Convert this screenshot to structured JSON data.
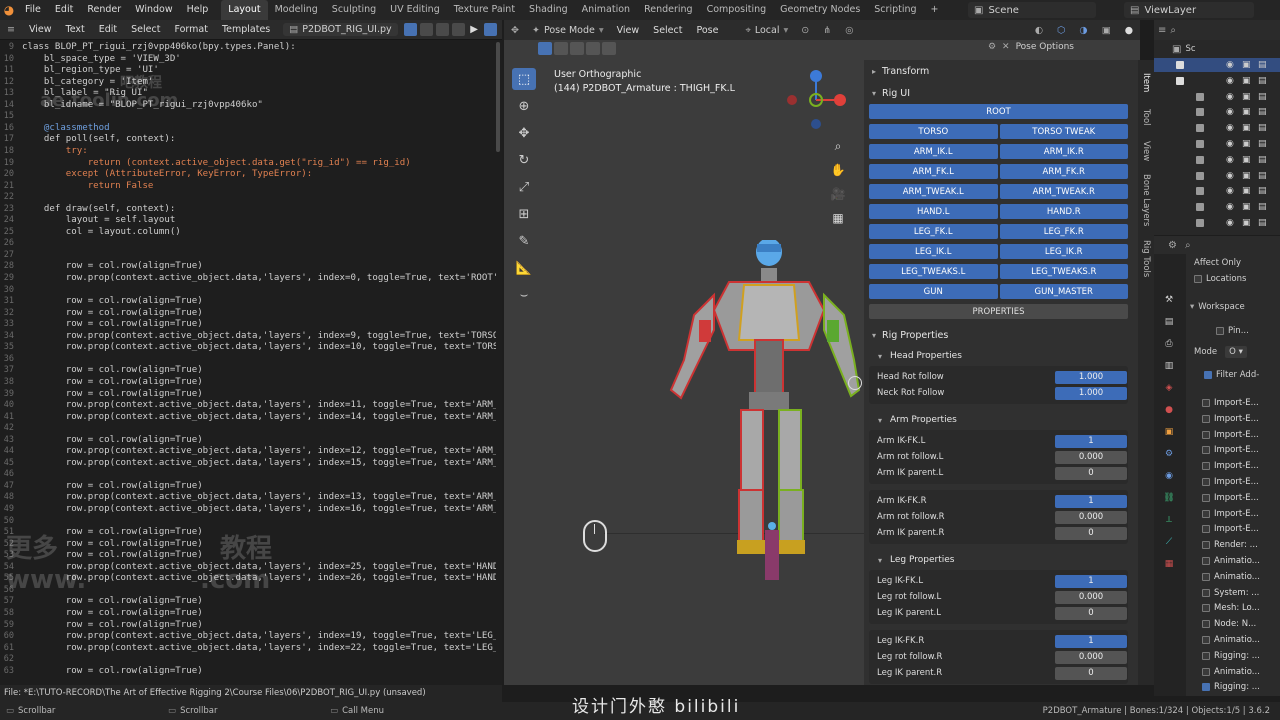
{
  "topbar": {
    "menus": [
      "File",
      "Edit",
      "Render",
      "Window",
      "Help"
    ],
    "workspaces": [
      "Layout",
      "Modeling",
      "Sculpting",
      "UV Editing",
      "Texture Paint",
      "Shading",
      "Animation",
      "Rendering",
      "Compositing",
      "Geometry Nodes",
      "Scripting"
    ],
    "active_workspace": "Layout",
    "add_tab": "+",
    "scene": "Scene",
    "view_layer": "ViewLayer"
  },
  "editor": {
    "menus": [
      "View",
      "Text",
      "Edit",
      "Select",
      "Format",
      "Templates"
    ],
    "filename": "P2DBOT_RIG_UI.py",
    "filepath": "File: *E:\\TUTO-RECORD\\The Art of Effective Rigging 2\\Course Files\\06\\P2DBOT_RIG_UI.py (unsaved)",
    "lines": [
      {
        "n": "9",
        "t": "class BLOP_PT_rigui_rzj0vpp406ko(bpy.types.Panel):"
      },
      {
        "n": "10",
        "t": "    bl_space_type = 'VIEW_3D'"
      },
      {
        "n": "11",
        "t": "    bl_region_type = 'UI'"
      },
      {
        "n": "12",
        "t": "    bl_category = 'Item'"
      },
      {
        "n": "13",
        "t": "    bl_label = \"Rig UI\""
      },
      {
        "n": "14",
        "t": "    bl_idname = \"BLOP_PT_rigui_rzj0vpp406ko\""
      },
      {
        "n": "15",
        "t": ""
      },
      {
        "n": "16",
        "t": "    @classmethod"
      },
      {
        "n": "17",
        "t": "    def poll(self, context):"
      },
      {
        "n": "18",
        "t": "        try:"
      },
      {
        "n": "19",
        "t": "            return (context.active_object.data.get(\"rig_id\") == rig_id)"
      },
      {
        "n": "20",
        "t": "        except (AttributeError, KeyError, TypeError):"
      },
      {
        "n": "21",
        "t": "            return False"
      },
      {
        "n": "22",
        "t": ""
      },
      {
        "n": "23",
        "t": "    def draw(self, context):"
      },
      {
        "n": "24",
        "t": "        layout = self.layout"
      },
      {
        "n": "25",
        "t": "        col = layout.column()"
      },
      {
        "n": "26",
        "t": ""
      },
      {
        "n": "27",
        "t": ""
      },
      {
        "n": "28",
        "t": "        row = col.row(align=True)"
      },
      {
        "n": "29",
        "t": "        row.prop(context.active_object.data,'layers', index=0, toggle=True, text='ROOT')"
      },
      {
        "n": "30",
        "t": ""
      },
      {
        "n": "31",
        "t": "        row = col.row(align=True)"
      },
      {
        "n": "32",
        "t": "        row = col.row(align=True)"
      },
      {
        "n": "33",
        "t": "        row = col.row(align=True)"
      },
      {
        "n": "34",
        "t": "        row.prop(context.active_object.data,'layers', index=9, toggle=True, text='TORSO')"
      },
      {
        "n": "35",
        "t": "        row.prop(context.active_object.data,'layers', index=10, toggle=True, text='TORSO"
      },
      {
        "n": "36",
        "t": ""
      },
      {
        "n": "37",
        "t": "        row = col.row(align=True)"
      },
      {
        "n": "38",
        "t": "        row = col.row(align=True)"
      },
      {
        "n": "39",
        "t": "        row = col.row(align=True)"
      },
      {
        "n": "40",
        "t": "        row.prop(context.active_object.data,'layers', index=11, toggle=True, text='ARM_IK"
      },
      {
        "n": "41",
        "t": "        row.prop(context.active_object.data,'layers', index=14, toggle=True, text='ARM_IK"
      },
      {
        "n": "42",
        "t": ""
      },
      {
        "n": "43",
        "t": "        row = col.row(align=True)"
      },
      {
        "n": "44",
        "t": "        row.prop(context.active_object.data,'layers', index=12, toggle=True, text='ARM_FK"
      },
      {
        "n": "45",
        "t": "        row.prop(context.active_object.data,'layers', index=15, toggle=True, text='ARM_FK"
      },
      {
        "n": "46",
        "t": ""
      },
      {
        "n": "47",
        "t": "        row = col.row(align=True)"
      },
      {
        "n": "48",
        "t": "        row.prop(context.active_object.data,'layers', index=13, toggle=True, text='ARM_TW"
      },
      {
        "n": "49",
        "t": "        row.prop(context.active_object.data,'layers', index=16, toggle=True, text='ARM_TW"
      },
      {
        "n": "50",
        "t": ""
      },
      {
        "n": "51",
        "t": "        row = col.row(align=True)"
      },
      {
        "n": "52",
        "t": "        row = col.row(align=True)"
      },
      {
        "n": "53",
        "t": "        row = col.row(align=True)"
      },
      {
        "n": "54",
        "t": "        row.prop(context.active_object.data,'layers', index=25, toggle=True, text='HAND.L"
      },
      {
        "n": "55",
        "t": "        row.prop(context.active_object.data,'layers', index=26, toggle=True, text='HAND.R"
      },
      {
        "n": "56",
        "t": ""
      },
      {
        "n": "57",
        "t": "        row = col.row(align=True)"
      },
      {
        "n": "58",
        "t": "        row = col.row(align=True)"
      },
      {
        "n": "59",
        "t": "        row = col.row(align=True)"
      },
      {
        "n": "60",
        "t": "        row.prop(context.active_object.data,'layers', index=19, toggle=True, text='LEG_FK"
      },
      {
        "n": "61",
        "t": "        row.prop(context.active_object.data,'layers', index=22, toggle=True, text='LEG_FK"
      },
      {
        "n": "62",
        "t": ""
      },
      {
        "n": "63",
        "t": "        row = col.row(align=True)"
      }
    ],
    "watermark_lines": [
      "更多",
      "教程",
      "www.",
      ".com",
      "ae.toolin.com",
      "吧教程"
    ]
  },
  "viewport": {
    "mode": "Pose Mode",
    "menus": [
      "View",
      "Select",
      "Pose"
    ],
    "orientation": "Local",
    "pose_options": "Pose Options",
    "view_name": "User Orthographic",
    "active_info": "(144) P2DBOT_Armature : THIGH_FK.L"
  },
  "npanel": {
    "transform_label": "Transform",
    "rigui_label": "Rig UI",
    "root_button": "ROOT",
    "button_rows": [
      [
        "TORSO",
        "TORSO TWEAK"
      ],
      [
        "ARM_IK.L",
        "ARM_IK.R"
      ],
      [
        "ARM_FK.L",
        "ARM_FK.R"
      ],
      [
        "ARM_TWEAK.L",
        "ARM_TWEAK.R"
      ],
      [
        "HAND.L",
        "HAND.R"
      ],
      [
        "LEG_FK.L",
        "LEG_FK.R"
      ],
      [
        "LEG_IK.L",
        "LEG_IK.R"
      ],
      [
        "LEG_TWEAKS.L",
        "LEG_TWEAKS.R"
      ],
      [
        "GUN",
        "GUN_MASTER"
      ]
    ],
    "properties_button": "PROPERTIES",
    "rig_properties_label": "Rig Properties",
    "head_properties_label": "Head Properties",
    "head_props": [
      {
        "label": "Head Rot follow",
        "value": "1.000"
      },
      {
        "label": "Neck Rot Follow",
        "value": "1.000"
      }
    ],
    "arm_properties_label": "Arm Properties",
    "arm_props_l": [
      {
        "label": "Arm IK-FK.L",
        "value": "1"
      },
      {
        "label": "Arm rot follow.L",
        "value": "0.000"
      },
      {
        "label": "Arm IK parent.L",
        "value": "0"
      }
    ],
    "arm_props_r": [
      {
        "label": "Arm IK-FK.R",
        "value": "1"
      },
      {
        "label": "Arm rot follow.R",
        "value": "0.000"
      },
      {
        "label": "Arm IK parent.R",
        "value": "0"
      }
    ],
    "leg_properties_label": "Leg Properties",
    "leg_props_l": [
      {
        "label": "Leg IK-FK.L",
        "value": "1"
      },
      {
        "label": "Leg rot follow.L",
        "value": "0.000"
      },
      {
        "label": "Leg IK parent.L",
        "value": "0"
      }
    ],
    "leg_props_r": [
      {
        "label": "Leg IK-FK.R",
        "value": "1"
      },
      {
        "label": "Leg rot follow.R",
        "value": "0.000"
      },
      {
        "label": "Leg IK parent.R",
        "value": "0"
      }
    ],
    "vertical_tabs": [
      "Item",
      "Tool",
      "View",
      "Bone Layers",
      "Rig Tools"
    ]
  },
  "properties": {
    "affect_only": "Affect Only",
    "locations": "Locations",
    "workspace": "Workspace",
    "pin": "Pin...",
    "mode_label": "Mode",
    "mode_value": "O",
    "filter_addons": "Filter Add-",
    "addons": [
      {
        "name": "Import-E...",
        "on": false
      },
      {
        "name": "Import-E...",
        "on": false
      },
      {
        "name": "Import-E...",
        "on": false
      },
      {
        "name": "Import-E...",
        "on": false
      },
      {
        "name": "Import-E...",
        "on": false
      },
      {
        "name": "Import-E...",
        "on": false
      },
      {
        "name": "Import-E...",
        "on": false
      },
      {
        "name": "Import-E...",
        "on": false
      },
      {
        "name": "Import-E...",
        "on": false
      },
      {
        "name": "Render: ...",
        "on": false
      },
      {
        "name": "Animatio...",
        "on": false
      },
      {
        "name": "Animatio...",
        "on": false
      },
      {
        "name": "System: ...",
        "on": false
      },
      {
        "name": "Mesh: Lo...",
        "on": false
      },
      {
        "name": "Node: N...",
        "on": false
      },
      {
        "name": "Animatio...",
        "on": false
      },
      {
        "name": "Rigging: ...",
        "on": false
      },
      {
        "name": "Animatio...",
        "on": false
      },
      {
        "name": "Rigging: ...",
        "on": true
      }
    ],
    "outliner_header": "Sc"
  },
  "statusbar": {
    "left1": "Scrollbar",
    "left2": "Scrollbar",
    "left3": "Call Menu",
    "right": "P2DBOT_Armature | Bones:1/324 | Objects:1/5 | 3.6.2"
  },
  "overlay": {
    "subtitle": "设计门外憨 bilibili"
  },
  "colors": {
    "accent": "#4772b3",
    "rig_button": "#3d6cb8",
    "x_axis": "#e0403a",
    "y_axis": "#7ab020",
    "z_axis": "#3c7ad8"
  }
}
